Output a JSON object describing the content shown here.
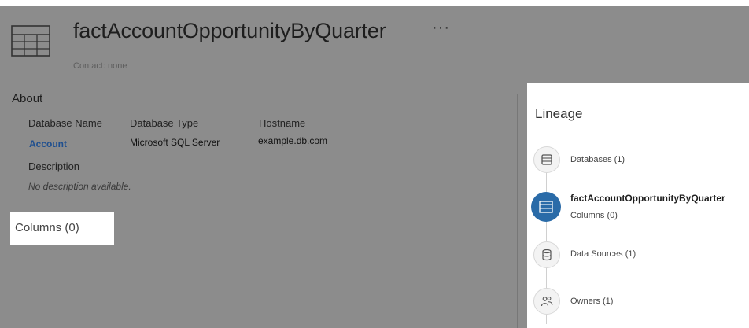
{
  "header": {
    "title": "factAccountOpportunityByQuarter",
    "more": "···",
    "contact": "Contact: none"
  },
  "about": {
    "heading": "About",
    "database_name_label": "Database Name",
    "database_name_value": "Account",
    "database_type_label": "Database Type",
    "database_type_value": "Microsoft SQL Server",
    "hostname_label": "Hostname",
    "hostname_value": "example.db.com",
    "description_label": "Description",
    "description_value": "No description available."
  },
  "columns": {
    "label": "Columns (0)"
  },
  "lineage": {
    "title": "Lineage",
    "databases": "Databases (1)",
    "table_name": "factAccountOpportunityByQuarter",
    "columns": "Columns (0)",
    "data_sources": "Data Sources (1)",
    "owners": "Owners (1)"
  },
  "colors": {
    "overlay": "#8c8c8c",
    "link": "#1f4f8f",
    "active_node": "#2a6ba8"
  }
}
